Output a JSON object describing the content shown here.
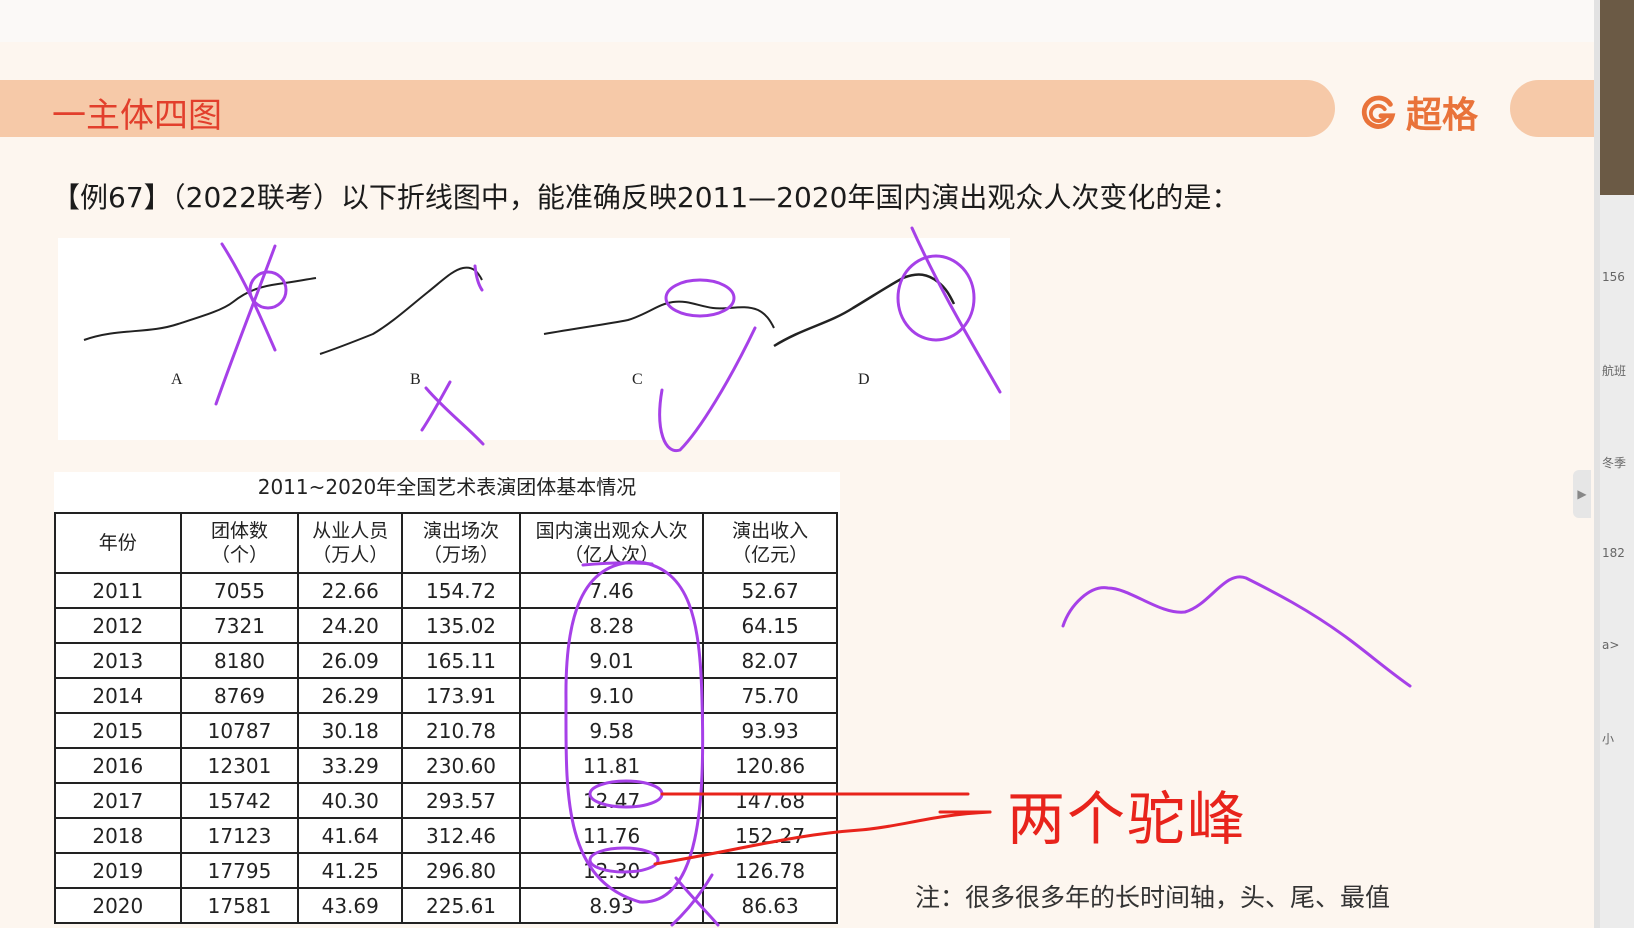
{
  "header": {
    "section_title": "一主体四图",
    "brand_name": "超格"
  },
  "question": {
    "text": "【例67】（2022联考）以下折线图中，能准确反映2011—2020年国内演出观众人次变化的是："
  },
  "options": [
    {
      "label": "A"
    },
    {
      "label": "B"
    },
    {
      "label": "C"
    },
    {
      "label": "D"
    }
  ],
  "table": {
    "title": "2011~2020年全国艺术表演团体基本情况",
    "headers": [
      "年份",
      "团体数\n（个）",
      "从业人员\n（万人）",
      "演出场次\n（万场）",
      "国内演出观众人次\n（亿人次）",
      "演出收入\n（亿元）"
    ],
    "rows": [
      [
        "2011",
        "7055",
        "22.66",
        "154.72",
        "7.46",
        "52.67"
      ],
      [
        "2012",
        "7321",
        "24.20",
        "135.02",
        "8.28",
        "64.15"
      ],
      [
        "2013",
        "8180",
        "26.09",
        "165.11",
        "9.01",
        "82.07"
      ],
      [
        "2014",
        "8769",
        "26.29",
        "173.91",
        "9.10",
        "75.70"
      ],
      [
        "2015",
        "10787",
        "30.18",
        "210.78",
        "9.58",
        "93.93"
      ],
      [
        "2016",
        "12301",
        "33.29",
        "230.60",
        "11.81",
        "120.86"
      ],
      [
        "2017",
        "15742",
        "40.30",
        "293.57",
        "12.47",
        "147.68"
      ],
      [
        "2018",
        "17123",
        "41.64",
        "312.46",
        "11.76",
        "152.27"
      ],
      [
        "2019",
        "17795",
        "41.25",
        "296.80",
        "12.30",
        "126.78"
      ],
      [
        "2020",
        "17581",
        "43.69",
        "225.61",
        "8.93",
        "86.63"
      ]
    ]
  },
  "annotation": {
    "text": "两个驼峰"
  },
  "note": {
    "text": "注：很多很多年的长时间轴，头、尾、最值"
  },
  "side_panel": {
    "items": [
      "156",
      "航班",
      "冬季",
      "182",
      "a>",
      "小"
    ]
  },
  "colors": {
    "banner": "#f6c9a8",
    "title_red": "#e23f2c",
    "brand_orange": "#e9733a",
    "ink_purple": "#a640e8",
    "ink_red": "#e8231b"
  }
}
